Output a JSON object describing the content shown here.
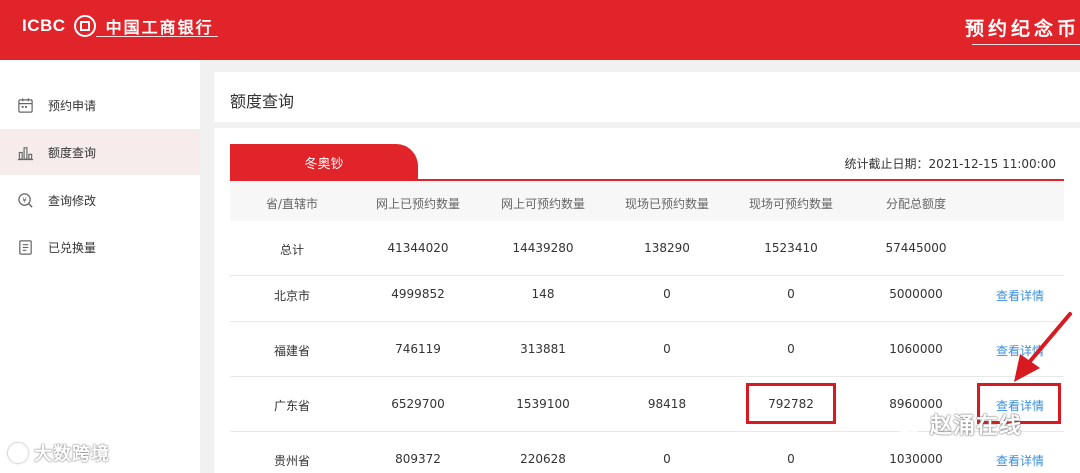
{
  "header": {
    "brand_en": "ICBC",
    "brand_cn": "中国工商银行",
    "right_title": "预约纪念币",
    "color": "#e0242a"
  },
  "sidebar": {
    "items": [
      {
        "label": "预约申请",
        "icon": "calendar-icon"
      },
      {
        "label": "额度查询",
        "icon": "bar-chart-icon",
        "active": true
      },
      {
        "label": "查询修改",
        "icon": "coin-search-icon"
      },
      {
        "label": "已兑换量",
        "icon": "ledger-icon"
      }
    ]
  },
  "main": {
    "page_title": "额度查询",
    "tab_label": "冬奥钞",
    "stat_date": "统计截止日期：2021-12-15 11:00:00",
    "table": {
      "columns": [
        "省/直辖市",
        "网上已预约数量",
        "网上可预约数量",
        "现场已预约数量",
        "现场可预约数量",
        "分配总额度",
        ""
      ],
      "rows": [
        {
          "province": "总计",
          "online_booked": "41344020",
          "online_available": "14439280",
          "onsite_booked": "138290",
          "onsite_available": "1523410",
          "total_quota": "57445000",
          "action": ""
        },
        {
          "province": "北京市",
          "online_booked": "4999852",
          "online_available": "148",
          "onsite_booked": "0",
          "onsite_available": "0",
          "total_quota": "5000000",
          "action": "查看详情"
        },
        {
          "province": "福建省",
          "online_booked": "746119",
          "online_available": "313881",
          "onsite_booked": "0",
          "onsite_available": "0",
          "total_quota": "1060000",
          "action": "查看详情"
        },
        {
          "province": "广东省",
          "online_booked": "6529700",
          "online_available": "1539100",
          "onsite_booked": "98418",
          "onsite_available": "792782",
          "total_quota": "8960000",
          "action": "查看详情"
        },
        {
          "province": "贵州省",
          "online_booked": "809372",
          "online_available": "220628",
          "onsite_booked": "0",
          "onsite_available": "0",
          "total_quota": "1030000",
          "action": "查看详情"
        }
      ]
    },
    "link_color": "#3b8fdc"
  },
  "watermarks": {
    "left": "大数跨境",
    "right": "赵涌在线"
  }
}
